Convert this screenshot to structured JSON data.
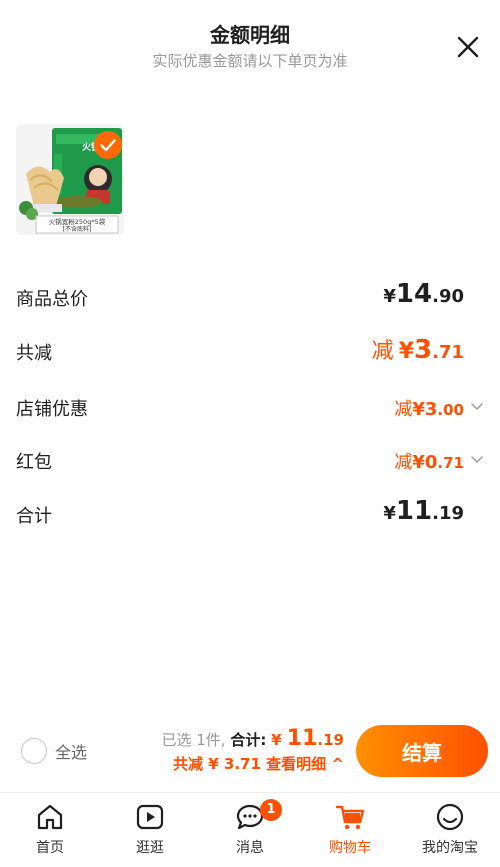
{
  "header": {
    "title": "金额明细",
    "subtitle": "实际优惠金额请以下单页为准"
  },
  "product": {
    "packet_brand": "火锅",
    "caption_line1": "火锅宽粉250g*5袋",
    "caption_line2": "[不含底料]",
    "selected": true
  },
  "rows": [
    {
      "label": "商品总价",
      "prefix": "",
      "currency": "¥",
      "int": "14",
      "dec": ".90",
      "style": "dark-big",
      "dropdown": false
    },
    {
      "label": "共减",
      "prefix": "减",
      "currency": "¥",
      "int": "3",
      "dec": ".71",
      "style": "orange-big",
      "dropdown": false
    },
    {
      "label": "店铺优惠",
      "prefix": "减",
      "currency": "¥",
      "int": "3",
      "dec": ".00",
      "style": "orange-small",
      "dropdown": true
    },
    {
      "label": "红包",
      "prefix": "减",
      "currency": "¥",
      "int": "0",
      "dec": ".71",
      "style": "orange-small",
      "dropdown": true
    },
    {
      "label": "合计",
      "prefix": "",
      "currency": "¥",
      "int": "11",
      "dec": ".19",
      "style": "dark-big",
      "dropdown": false
    }
  ],
  "bottom_bar": {
    "select_all_label": "全选",
    "selected_count_text": "已选 1件,",
    "total_label": "合计:",
    "total_currency": "¥ ",
    "total_int": "11",
    "total_dec": ".19",
    "discount_text": "共减 ¥ 3.71",
    "detail_link": "查看明细",
    "detail_arrow": "^",
    "checkout_label": "结算"
  },
  "tabbar": {
    "items": [
      {
        "label": "首页",
        "icon": "home-icon",
        "active": false
      },
      {
        "label": "逛逛",
        "icon": "play-icon",
        "active": false
      },
      {
        "label": "消息",
        "icon": "message-icon",
        "active": false,
        "badge": "1"
      },
      {
        "label": "购物车",
        "icon": "cart-icon",
        "active": true
      },
      {
        "label": "我的淘宝",
        "icon": "profile-icon",
        "active": false
      }
    ]
  },
  "colors": {
    "accent": "#ff5000",
    "accent_gradient_start": "#ff9000",
    "text_dark": "#1f1f1f",
    "text_muted": "#999999"
  }
}
